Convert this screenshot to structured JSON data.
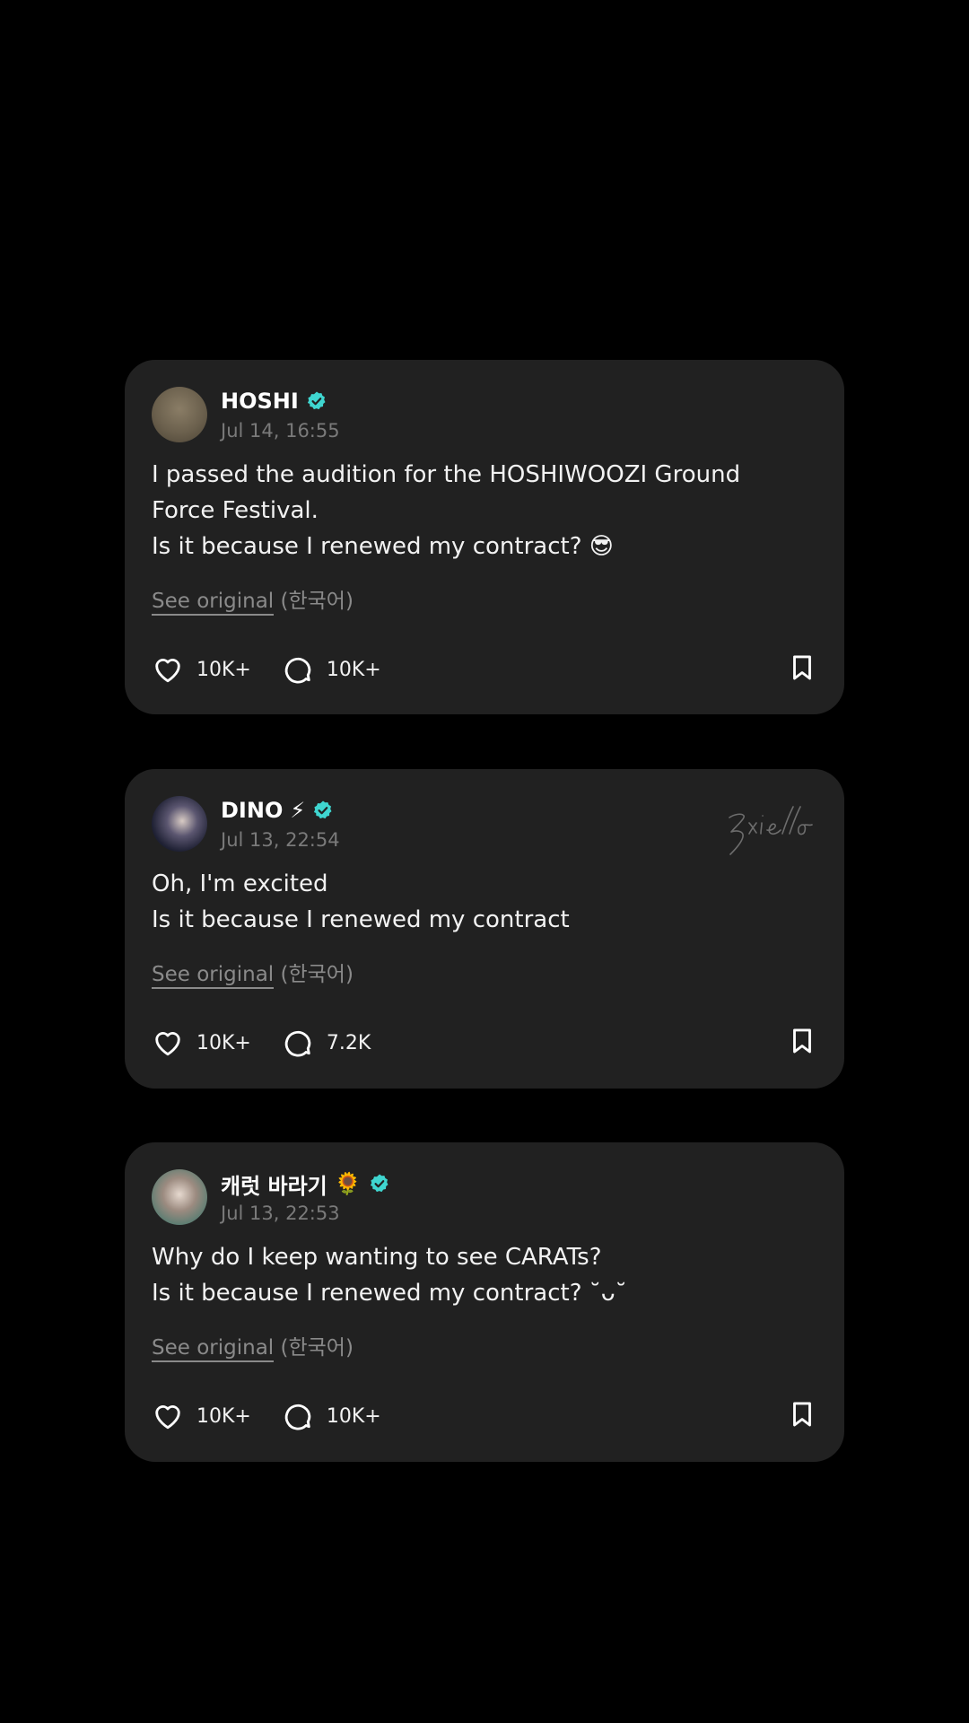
{
  "posts": [
    {
      "username": "HOSHI",
      "name_emoji": "",
      "timestamp": "Jul 14, 16:55",
      "text": "I passed the audition for the HOSHIWOOZI Ground\nForce Festival.\nIs it because I renewed my contract? 😎",
      "see_original": "See original",
      "language": "(한국어)",
      "likes": "10K+",
      "comments": "10K+",
      "avatar_icon": "avatar-photo"
    },
    {
      "username": "DINO",
      "name_emoji": "⚡",
      "timestamp": "Jul 13, 22:54",
      "text": "Oh, I'm excited\nIs it because I renewed my contract",
      "see_original": "See original",
      "language": "(한국어)",
      "likes": "10K+",
      "comments": "7.2K",
      "avatar_icon": "avatar-photo",
      "watermark": "zxiello"
    },
    {
      "username": "캐럿 바라기",
      "name_emoji": "🌻",
      "timestamp": "Jul 13, 22:53",
      "text": "Why do I keep wanting to see CARATs?\nIs it because I renewed my contract? ˘ᴗ˘",
      "see_original": "See original",
      "language": "(한국어)",
      "likes": "10K+",
      "comments": "10K+",
      "avatar_icon": "avatar-photo"
    }
  ],
  "colors": {
    "background": "#000000",
    "card": "#212121",
    "verified": "#3fd6d0",
    "muted_text": "#7a7a7a"
  },
  "icons": {
    "like": "heart-icon",
    "comment": "comment-bubble-icon",
    "save": "bookmark-icon",
    "verified": "verified-badge-icon"
  }
}
